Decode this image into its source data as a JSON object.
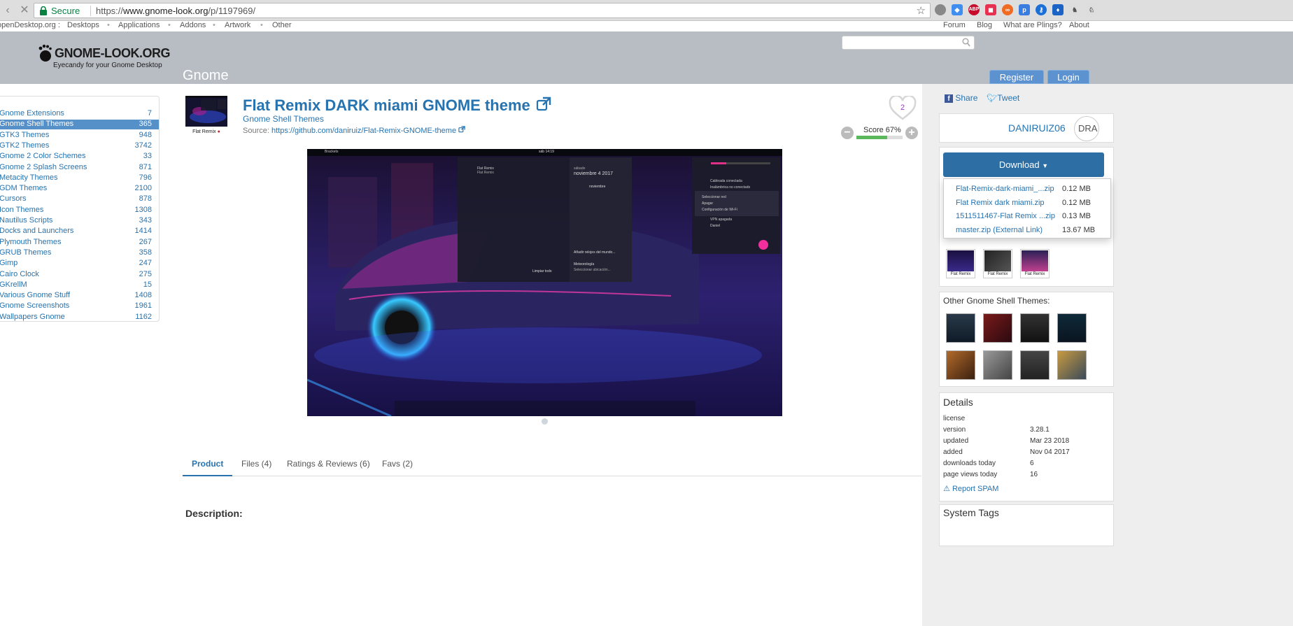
{
  "browser": {
    "secure_label": "Secure",
    "url_scheme": "https://",
    "url_host": "www.gnome-look.org",
    "url_path": "/p/1197969/",
    "extensions": [
      {
        "icon": "abp-icon",
        "text": "ABP",
        "color": "#c70d2c"
      },
      {
        "icon": "infinity-icon",
        "text": "∞",
        "color": "#f06a22"
      }
    ]
  },
  "topnav": {
    "brand": "openDesktop.org :",
    "links": [
      "Desktops",
      "Applications",
      "Addons",
      "Artwork",
      "Other"
    ],
    "right_links": [
      "Forum",
      "Blog",
      "What are Plings?",
      "About"
    ]
  },
  "header": {
    "logo_name": "GNOME-LOOK.ORG",
    "logo_tagline": "Eyecandy for your Gnome Desktop",
    "section_title": "Gnome",
    "register_label": "Register",
    "login_label": "Login"
  },
  "categories": [
    {
      "name": "Gnome Extensions",
      "count": "7"
    },
    {
      "name": "Gnome Shell Themes",
      "count": "365",
      "active": true
    },
    {
      "name": "GTK3 Themes",
      "count": "948"
    },
    {
      "name": "GTK2 Themes",
      "count": "3742"
    },
    {
      "name": "Gnome 2 Color Schemes",
      "count": "33"
    },
    {
      "name": "Gnome 2 Splash Screens",
      "count": "871"
    },
    {
      "name": "Metacity Themes",
      "count": "796"
    },
    {
      "name": "GDM Themes",
      "count": "2100"
    },
    {
      "name": "Cursors",
      "count": "878"
    },
    {
      "name": "Icon Themes",
      "count": "1308"
    },
    {
      "name": "Nautilus Scripts",
      "count": "343"
    },
    {
      "name": "Docks and Launchers",
      "count": "1414"
    },
    {
      "name": "Plymouth Themes",
      "count": "267"
    },
    {
      "name": "GRUB Themes",
      "count": "358"
    },
    {
      "name": "Gimp",
      "count": "247"
    },
    {
      "name": "Cairo Clock",
      "count": "275"
    },
    {
      "name": "GKrellM",
      "count": "15"
    },
    {
      "name": "Various Gnome Stuff",
      "count": "1408"
    },
    {
      "name": "Gnome Screenshots",
      "count": "1961"
    },
    {
      "name": "Wallpapers Gnome",
      "count": "1162"
    }
  ],
  "product": {
    "thumb_label": "Flat Remix",
    "title": "Flat Remix DARK miami GNOME theme",
    "category": "Gnome Shell Themes",
    "source_label": "Source:",
    "source_url": "https://github.com/daniruiz/Flat-Remix-GNOME-theme",
    "fav_count": "2",
    "score_label": "Score 67%",
    "score_fraction": 0.67
  },
  "screenshot": {
    "topbar_left": "Brackets",
    "topbar_clock": "sáb 14:19",
    "notif_title": "Flat Remix",
    "notif_sub": "Flat Remix",
    "cal_day": "sábado",
    "cal_date": "noviembre 4 2017",
    "cal_month": "noviembre",
    "add_clocks": "Añadir relojes del mundo...",
    "weather": "Meteorología",
    "weather_sub": "Seleccionar ubicación...",
    "clear_all": "Limpiar todo",
    "menu_wired": "Cableada conectada",
    "menu_wifi": "Inalámbrica no conectado",
    "menu_select": "Seleccionar red",
    "menu_off": "Apagar",
    "menu_wifi_settings": "Configuración de Wi-Fi",
    "menu_vpn": "VPN apagada",
    "menu_user": "Daniel"
  },
  "tabs": [
    {
      "label": "Product",
      "active": true
    },
    {
      "label": "Files (4)"
    },
    {
      "label": "Ratings & Reviews (6)"
    },
    {
      "label": "Favs (2)"
    }
  ],
  "description_title": "Description:",
  "share": {
    "share_label": "Share",
    "tweet_label": "Tweet"
  },
  "user": {
    "name": "DANIRUIZ06",
    "avatar_text": "DRA"
  },
  "download": {
    "button_label": "Download",
    "files": [
      {
        "name": "Flat-Remix-dark-miami_...zip",
        "size": "0.12 MB"
      },
      {
        "name": "Flat Remix dark miami.zip",
        "size": "0.12 MB"
      },
      {
        "name": "1511511467-Flat Remix ...zip",
        "size": "0.13 MB"
      },
      {
        "name": "master.zip (External Link)",
        "size": "13.67 MB"
      }
    ]
  },
  "gallery_thumb_label": "Flat Remix",
  "other_title": "Other Gnome Shell Themes:",
  "details": {
    "title": "Details",
    "rows": [
      {
        "label": "license",
        "value": ""
      },
      {
        "label": "version",
        "value": "3.28.1"
      },
      {
        "label": "updated",
        "value": "Mar 23 2018"
      },
      {
        "label": "added",
        "value": "Nov 04 2017"
      },
      {
        "label": "downloads today",
        "value": "6"
      },
      {
        "label": "page views today",
        "value": "16"
      }
    ],
    "report_label": "Report SPAM"
  },
  "system_tags_title": "System Tags",
  "colors": {
    "link": "#2673b0",
    "header_bg": "#b8bcc3",
    "active_cat": "#5590c9",
    "download_btn": "#2d6ea5"
  }
}
